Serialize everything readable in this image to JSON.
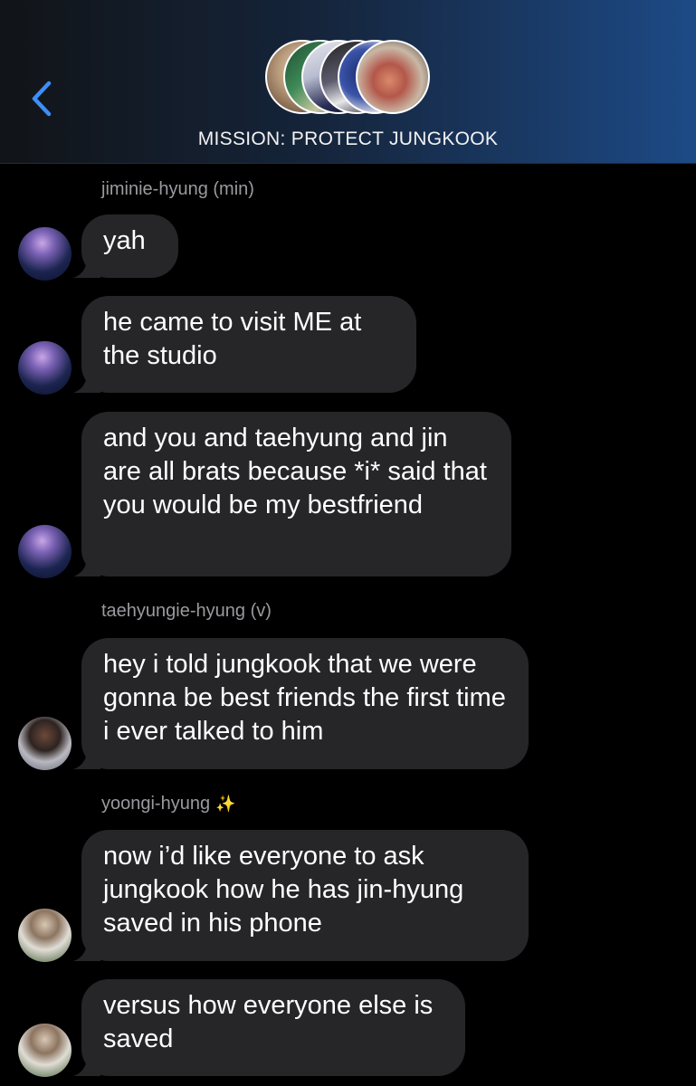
{
  "header": {
    "title": "MISSION: PROTECT JUNGKOOK",
    "back_icon": "chevron-left-icon",
    "accent": "#3e8ef7"
  },
  "messages": [
    {
      "sender": "jiminie-hyung (min)",
      "text": "yah"
    },
    {
      "text": "he came to visit ME at the studio"
    },
    {
      "text": "and you and taehyung and jin are all brats because *i* said that you would be my bestfriend"
    },
    {
      "sender": "taehyungie-hyung (v)",
      "text": "hey i told jungkook that we were gonna be best friends the first time i ever talked to him"
    },
    {
      "sender": "yoongi-hyung",
      "sender_emoji": "✨",
      "text": "now i’d like everyone to ask jungkook how he has jin-hyung saved in his phone"
    },
    {
      "text": "versus how everyone else is saved"
    }
  ],
  "colors": {
    "bubble": "#262628",
    "sender_name": "#9a9a9f",
    "background": "#000000"
  }
}
